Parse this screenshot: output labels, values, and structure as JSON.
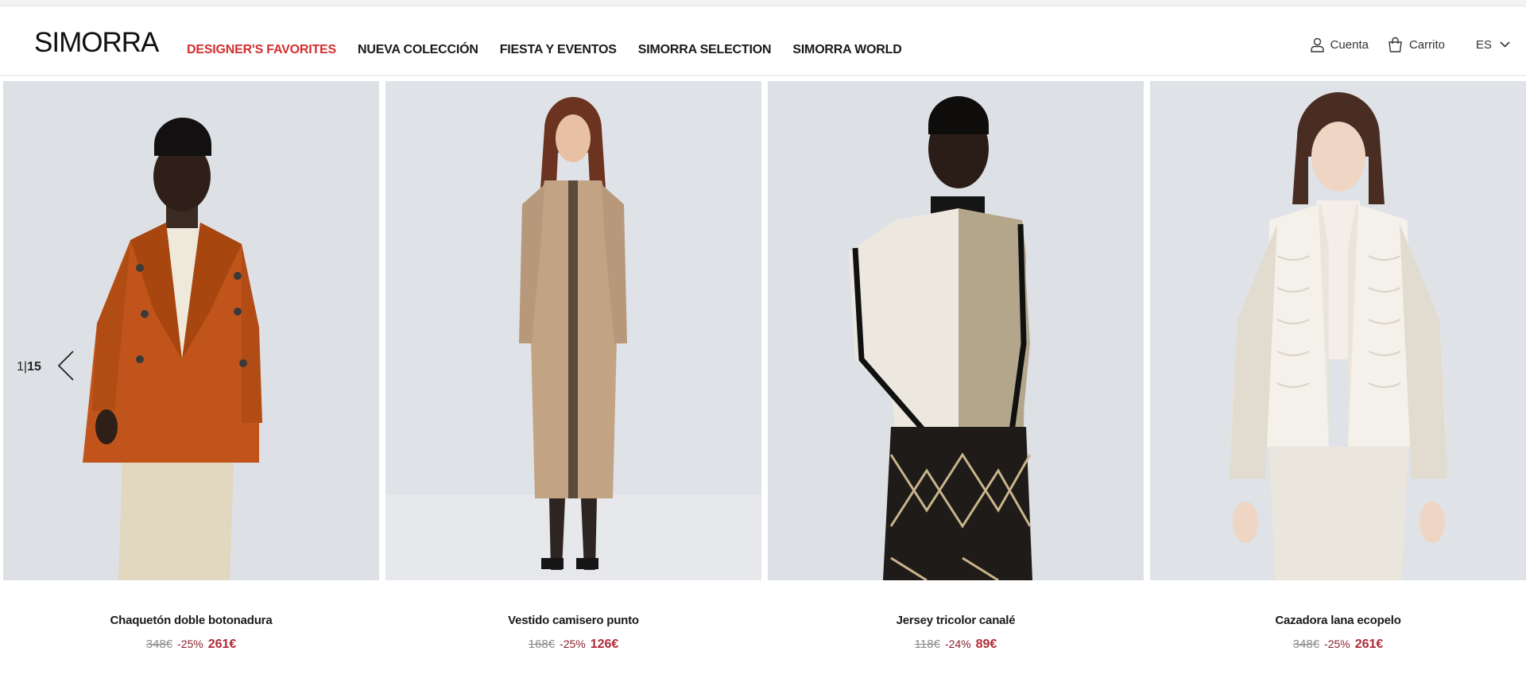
{
  "brand": {
    "logo": "SIMORRA"
  },
  "nav": {
    "items": [
      {
        "label": "DESIGNER'S FAVORITES",
        "active": true
      },
      {
        "label": "NUEVA COLECCIÓN",
        "active": false
      },
      {
        "label": "FIESTA Y EVENTOS",
        "active": false
      },
      {
        "label": "SIMORRA SELECTION",
        "active": false
      },
      {
        "label": "SIMORRA WORLD",
        "active": false
      }
    ]
  },
  "tools": {
    "account": "Cuenta",
    "cart": "Carrito",
    "language": "ES"
  },
  "carousel": {
    "current": "1",
    "total": "15"
  },
  "products": [
    {
      "name": "Chaquetón doble botonadura",
      "old_price": "348€",
      "discount": "-25%",
      "price": "261€"
    },
    {
      "name": "Vestido camisero punto",
      "old_price": "168€",
      "discount": "-25%",
      "price": "126€"
    },
    {
      "name": "Jersey tricolor canalé",
      "old_price": "118€",
      "discount": "-24%",
      "price": "89€"
    },
    {
      "name": "Cazadora lana ecopelo",
      "old_price": "348€",
      "discount": "-25%",
      "price": "261€"
    }
  ],
  "colors": {
    "accent": "#d32f2f",
    "sale": "#b02a37"
  }
}
